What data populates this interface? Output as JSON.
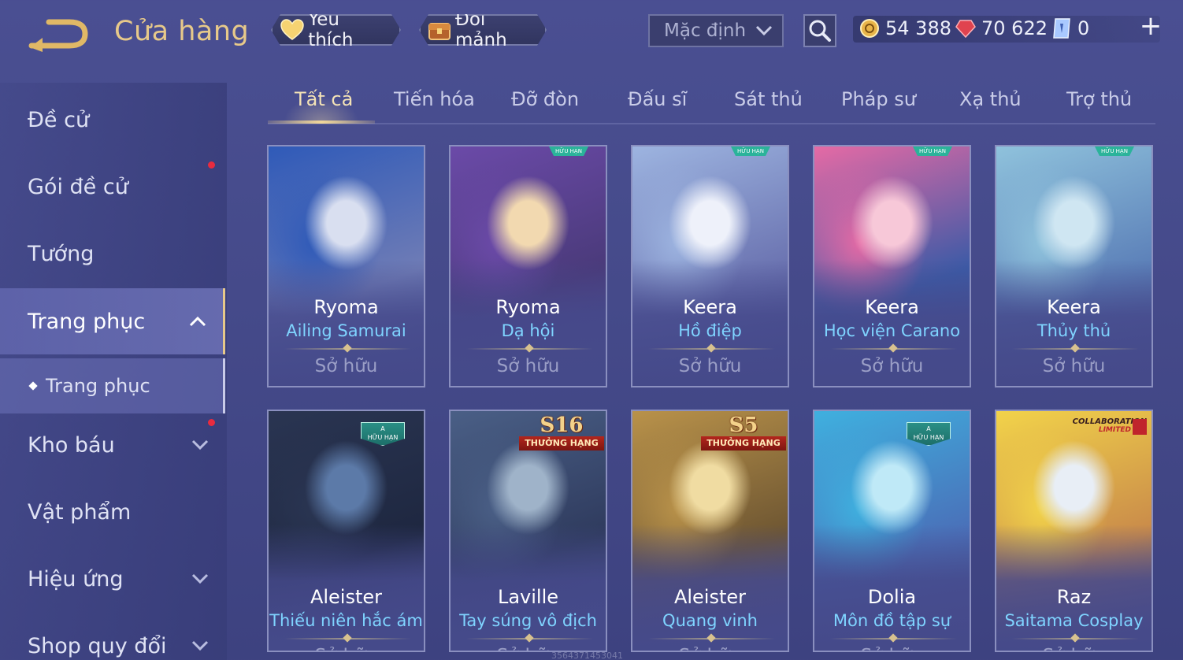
{
  "header": {
    "title": "Cửa hàng",
    "favorites_label": "Yêu thích",
    "exchange_label": "Đổi mảnh",
    "sort_selected": "Mặc định",
    "currencies": {
      "gold": "54 388",
      "ruby": "70 622",
      "voucher": "0"
    },
    "add_label": "+"
  },
  "sidebar": {
    "items": [
      {
        "label": "Đề cử"
      },
      {
        "label": "Gói đề cử"
      },
      {
        "label": "Tướng"
      },
      {
        "label": "Trang phục"
      },
      {
        "label": "Trang phục"
      },
      {
        "label": "Kho báu"
      },
      {
        "label": "Vật phẩm"
      },
      {
        "label": "Hiệu ứng"
      },
      {
        "label": "Shop quy đổi"
      }
    ]
  },
  "tabs": [
    "Tất cả",
    "Tiến hóa",
    "Đỡ đòn",
    "Đấu sĩ",
    "Sát thủ",
    "Pháp sư",
    "Xạ thủ",
    "Trợ thủ"
  ],
  "cards": [
    {
      "hero": "Ryoma",
      "skin": "Ailing Samurai",
      "status": "Sở hữu",
      "palette": [
        "#d9dff0",
        "#2f5ab8",
        "#6f7cb6"
      ]
    },
    {
      "hero": "Ryoma",
      "skin": "Dạ hội",
      "status": "Sở hữu",
      "badge": "HỮU HẠN",
      "palette": [
        "#f2d9b0",
        "#6b4aa8",
        "#4a3a7a"
      ]
    },
    {
      "hero": "Keera",
      "skin": "Hồ điệp",
      "status": "Sở hữu",
      "badge": "HỮU HẠN",
      "palette": [
        "#eef1fa",
        "#9db4e0",
        "#6a72b0"
      ]
    },
    {
      "hero": "Keera",
      "skin": "Học viện Carano",
      "status": "Sở hữu",
      "badge": "HỮU HẠN",
      "palette": [
        "#f7c8d8",
        "#e56aa5",
        "#3b5aa6"
      ]
    },
    {
      "hero": "Keera",
      "skin": "Thủy thủ",
      "status": "Sở hữu",
      "badge": "HỮU HẠN",
      "palette": [
        "#cfe6f2",
        "#8fc2dc",
        "#5b7fb8"
      ]
    },
    {
      "hero": "Aleister",
      "skin": "Thiếu niên hắc ám",
      "status": "Sở hữu",
      "badge_a": "HỮU HẠN",
      "palette": [
        "#5c7aa8",
        "#2a3552",
        "#1e2740"
      ]
    },
    {
      "hero": "Laville",
      "skin": "Tay súng vô địch",
      "status": "Sở hữu",
      "rank_season": "S16",
      "rank_label": "THƯỞNG HẠNG",
      "palette": [
        "#9fb3c9",
        "#4a5f86",
        "#2f3b5e"
      ]
    },
    {
      "hero": "Aleister",
      "skin": "Quang vinh",
      "status": "Sở hữu",
      "rank_season": "S5",
      "rank_label": "THƯỞNG HẠNG",
      "palette": [
        "#f0dca2",
        "#b9924a",
        "#6e5632"
      ]
    },
    {
      "hero": "Dolia",
      "skin": "Môn đồ tập sự",
      "status": "Sở hữu",
      "badge_a": "HỮU HẠN",
      "palette": [
        "#bfe9f7",
        "#3fb0df",
        "#4a6fb8"
      ]
    },
    {
      "hero": "Raz",
      "skin": "Saitama Cosplay",
      "status": "Sở hữu",
      "collab_1": "COLLABORATION",
      "collab_2": "LIMITED",
      "palette": [
        "#e8eef6",
        "#f2d34a",
        "#c98a4a"
      ]
    }
  ],
  "watermark": "3564371453041"
}
